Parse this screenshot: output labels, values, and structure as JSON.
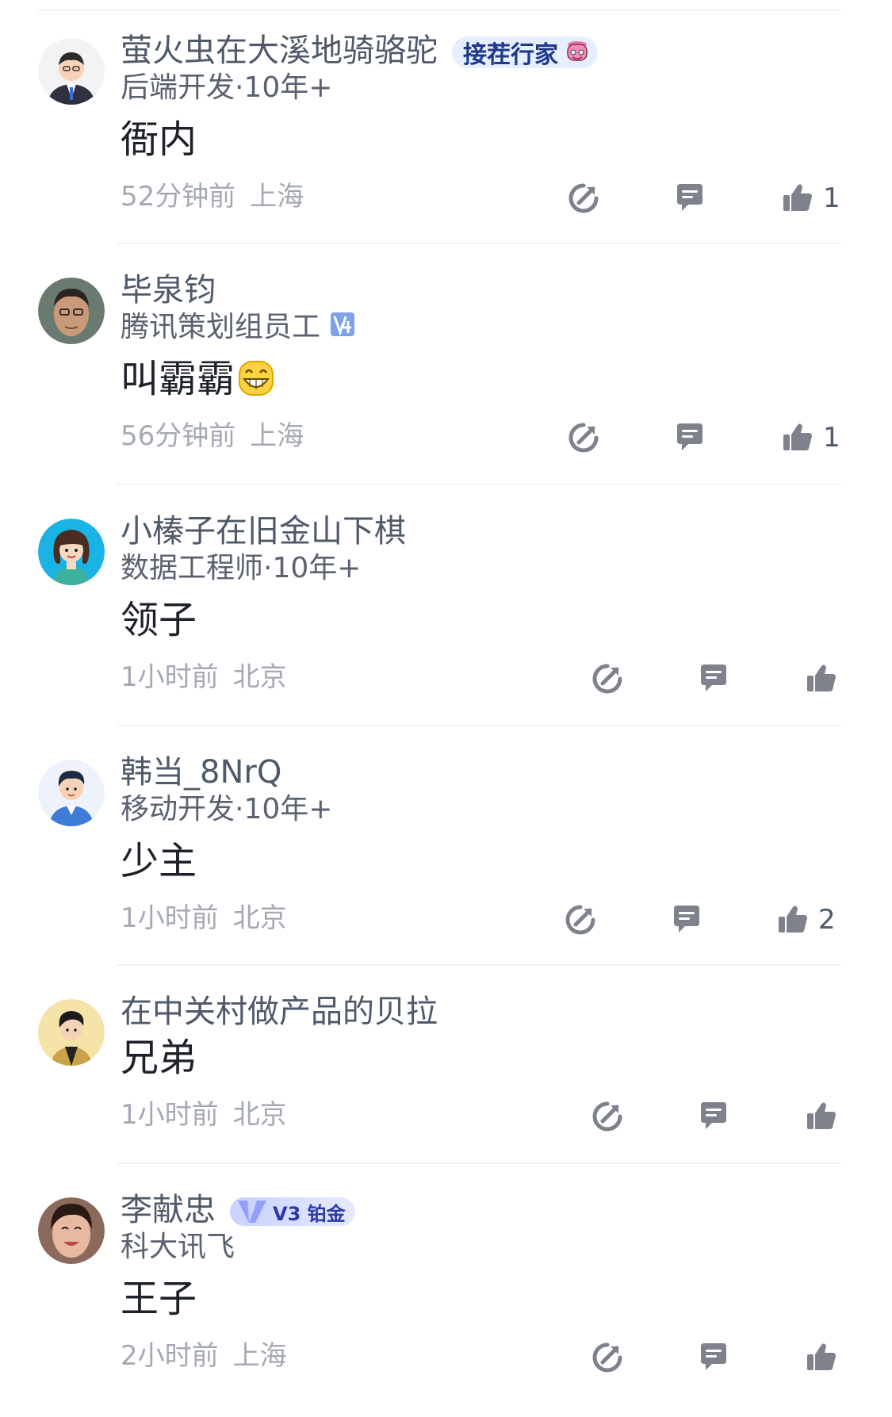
{
  "comments": [
    {
      "username": "萤火虫在大溪地骑骆驼",
      "badge_text": "接茬行家",
      "subtitle": "后端开发·10年+",
      "content": "衙内",
      "time": "52分钟前",
      "location": "上海",
      "likes": "1",
      "avatar": "avatar-man-suit"
    },
    {
      "username": "毕泉钧",
      "subtitle": "腾讯策划组员工",
      "subtitle_icon": "level-4-icon",
      "content": "叫霸霸",
      "content_emoji": "grinning-emoji",
      "time": "56分钟前",
      "location": "上海",
      "likes": "1",
      "avatar": "avatar-photo-man-glasses"
    },
    {
      "username": "小榛子在旧金山下棋",
      "subtitle": "数据工程师·10年+",
      "content": "领子",
      "time": "1小时前",
      "location": "北京",
      "likes": "",
      "avatar": "avatar-woman-cartoon"
    },
    {
      "username": "韩当_8NrQ",
      "subtitle": "移动开发·10年+",
      "content": "少主",
      "time": "1小时前",
      "location": "北京",
      "likes": "2",
      "avatar": "avatar-man-blue-jacket"
    },
    {
      "username": "在中关村做产品的贝拉",
      "subtitle": "",
      "content": "兄弟",
      "time": "1小时前",
      "location": "北京",
      "likes": "",
      "avatar": "avatar-man-yellow-bg"
    },
    {
      "username": "李献忠",
      "badge_text": "V3 铂金",
      "subtitle": "科大讯飞",
      "content": "王子",
      "time": "2小时前",
      "location": "上海",
      "likes": "",
      "avatar": "avatar-photo-woman"
    }
  ],
  "icons": {
    "share": "share-icon",
    "reply": "comment-icon",
    "like": "thumbs-up-icon"
  },
  "colors": {
    "text_primary": "#1d2129",
    "text_secondary": "#4e5969",
    "text_meta": "#a4a9b3",
    "icon_gray": "#7d828c",
    "badge_blue": "#e6efff"
  }
}
